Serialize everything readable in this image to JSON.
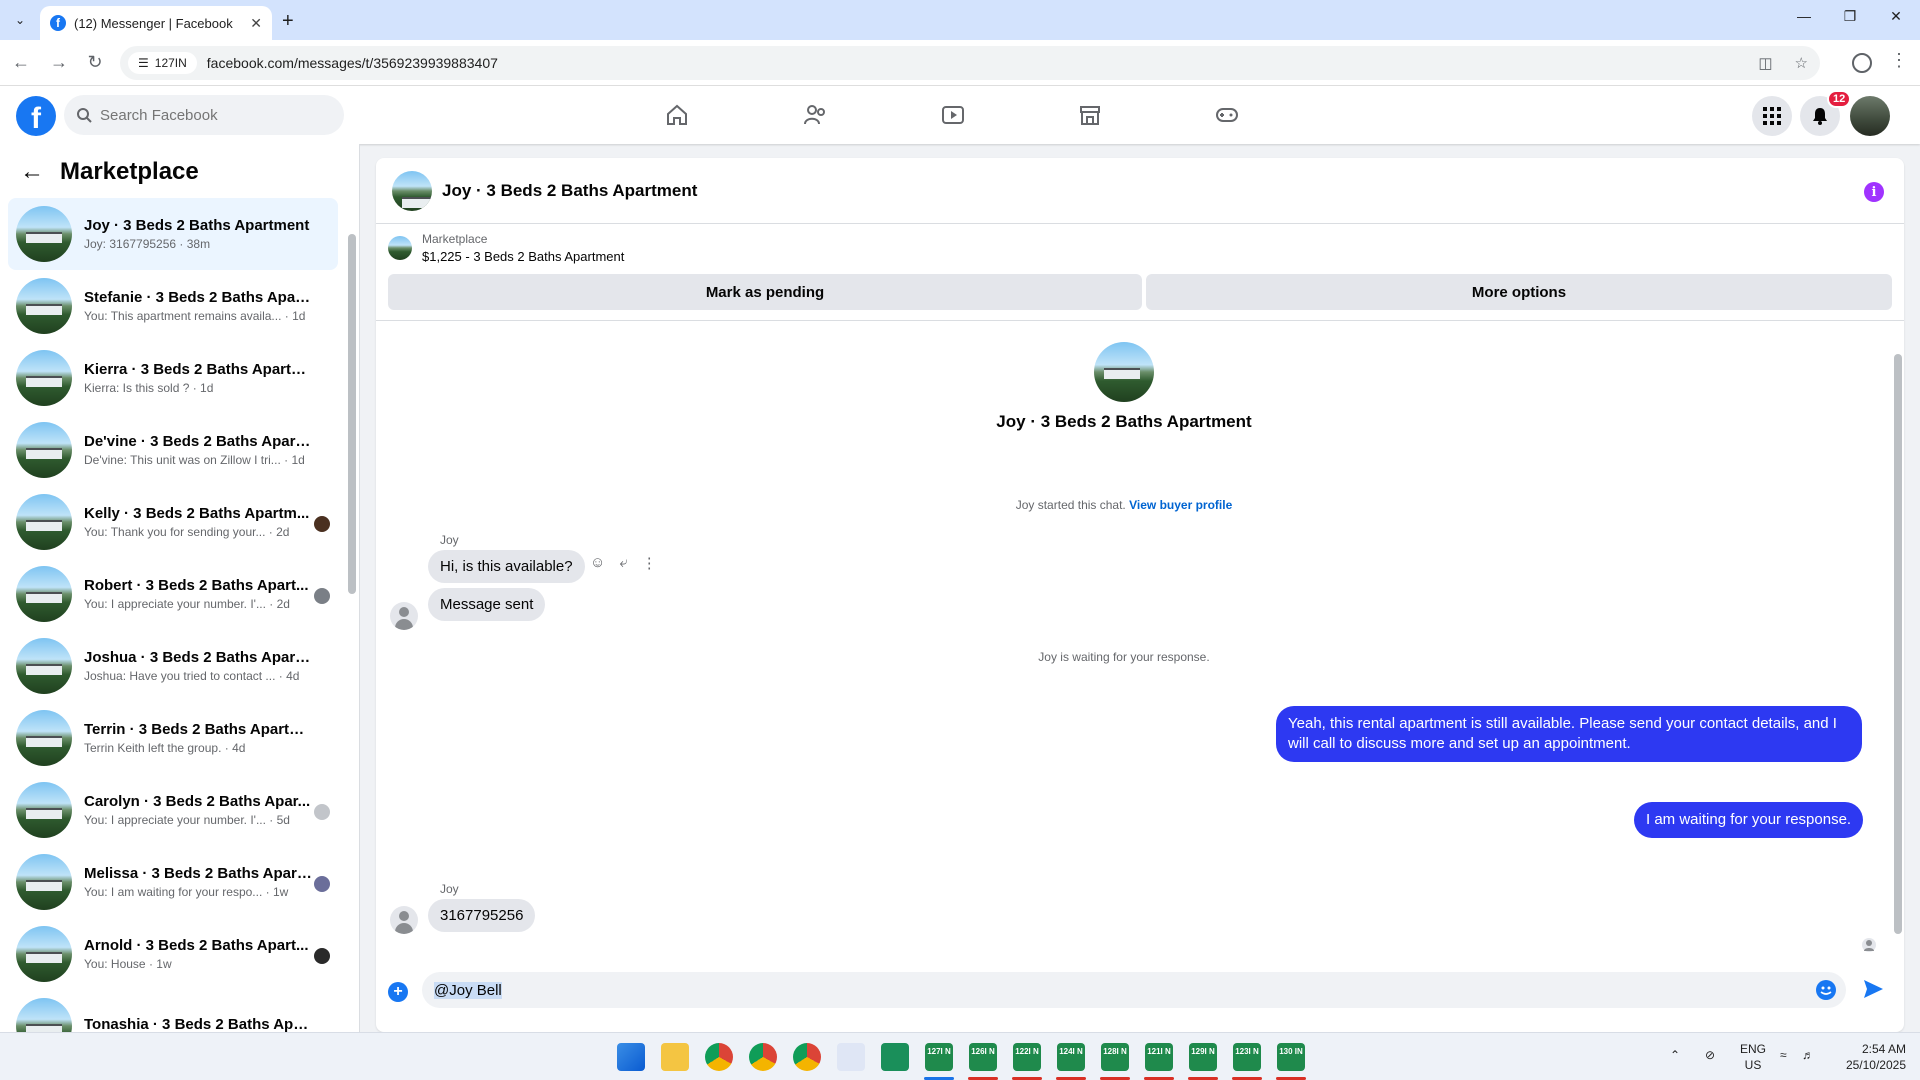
{
  "browser": {
    "tab_title": "(12) Messenger | Facebook",
    "site_info": "127IN",
    "url": "facebook.com/messages/t/3569239939883407"
  },
  "fb": {
    "search_placeholder": "Search Facebook",
    "notification_count": "12"
  },
  "sidebar": {
    "title": "Marketplace",
    "conversations": [
      {
        "name": "Joy · 3 Beds 2 Baths Apartment",
        "preview": "Joy: 3167795256 · 38m",
        "active": true,
        "dot": ""
      },
      {
        "name": "Stefanie · 3 Beds 2 Baths Apart...",
        "preview": "You: This apartment remains availa... · 1d",
        "active": false,
        "dot": ""
      },
      {
        "name": "Kierra · 3 Beds 2 Baths Apartment",
        "preview": "Kierra: Is this sold ? · 1d",
        "active": false,
        "dot": ""
      },
      {
        "name": "De'vine · 3 Beds 2 Baths Apartm...",
        "preview": "De'vine: This unit was on Zillow I tri... · 1d",
        "active": false,
        "dot": ""
      },
      {
        "name": "Kelly · 3 Beds 2 Baths Apartm...",
        "preview": "You: Thank you for sending your... · 2d",
        "active": false,
        "dot": "#4a3020"
      },
      {
        "name": "Robert · 3 Beds 2 Baths Apart...",
        "preview": "You: I appreciate your number. I'... · 2d",
        "active": false,
        "dot": "#7a7f86"
      },
      {
        "name": "Joshua · 3 Beds 2 Baths Apartm...",
        "preview": "Joshua: Have you tried to contact ... · 4d",
        "active": false,
        "dot": ""
      },
      {
        "name": "Terrin · 3 Beds 2 Baths Apartment",
        "preview": "Terrin Keith left the group. · 4d",
        "active": false,
        "dot": ""
      },
      {
        "name": "Carolyn · 3 Beds 2 Baths Apar...",
        "preview": "You: I appreciate your number. I'... · 5d",
        "active": false,
        "dot": "#c2c5ca"
      },
      {
        "name": "Melissa · 3 Beds 2 Baths Apart...",
        "preview": "You: I am waiting for your respo... · 1w",
        "active": false,
        "dot": "#6b6e9a"
      },
      {
        "name": "Arnold · 3 Beds 2 Baths Apart...",
        "preview": "You: House · 1w",
        "active": false,
        "dot": "#2a2a2a"
      },
      {
        "name": "Tonashia · 3 Beds 2 Baths Apart...",
        "preview": "",
        "active": false,
        "dot": ""
      }
    ]
  },
  "chat": {
    "title": "Joy · 3 Beds 2 Baths Apartment",
    "listing_kicker": "Marketplace",
    "listing_line": "$1,225 - 3 Beds 2 Baths Apartment",
    "mark_pending": "Mark as pending",
    "more_options": "More options",
    "center_name": "Joy · 3 Beds 2 Baths Apartment",
    "started_text": "Joy started this chat.",
    "view_profile": "View buyer profile",
    "sender1": "Joy",
    "msg1": "Hi, is this available?",
    "msg2": "Message sent",
    "waiting_text": "Joy is waiting for your response.",
    "out1": "Yeah, this rental apartment is still available. Please send your contact details, and I will call to discuss more and set up an appointment.",
    "out2": "I am waiting for your response.",
    "sender2": "Joy",
    "msg3": "3167795256",
    "composer_value": "@Joy Bell"
  },
  "taskbar": {
    "apps": [
      "127I N",
      "126I N",
      "122I N",
      "124I N",
      "128I N",
      "121I N",
      "129I N",
      "123I N",
      "130 IN"
    ],
    "lang1": "ENG",
    "lang2": "US",
    "time": "2:54 AM",
    "date": "25/10/2025"
  },
  "colors": {
    "fb_blue": "#1877f2",
    "outgoing_bubble": "#2d39f2",
    "incoming_bubble": "#e4e6eb",
    "info_purple": "#a033ff"
  }
}
